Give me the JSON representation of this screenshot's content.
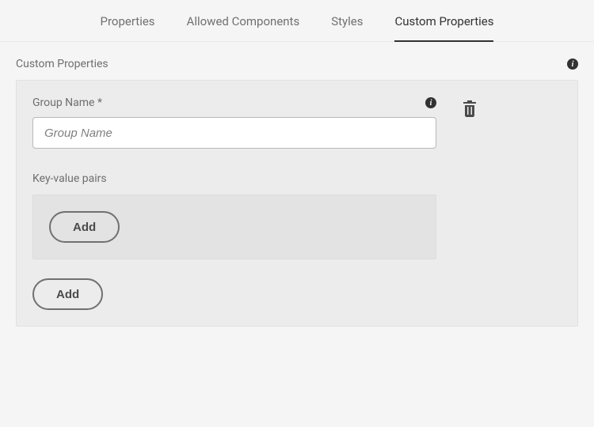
{
  "tabs": {
    "properties": "Properties",
    "allowed_components": "Allowed Components",
    "styles": "Styles",
    "custom_properties": "Custom Properties"
  },
  "section": {
    "title": "Custom Properties"
  },
  "group": {
    "name_label": "Group Name *",
    "name_placeholder": "Group Name",
    "name_value": ""
  },
  "kv": {
    "label": "Key-value pairs",
    "add_label": "Add"
  },
  "buttons": {
    "add_group": "Add"
  }
}
